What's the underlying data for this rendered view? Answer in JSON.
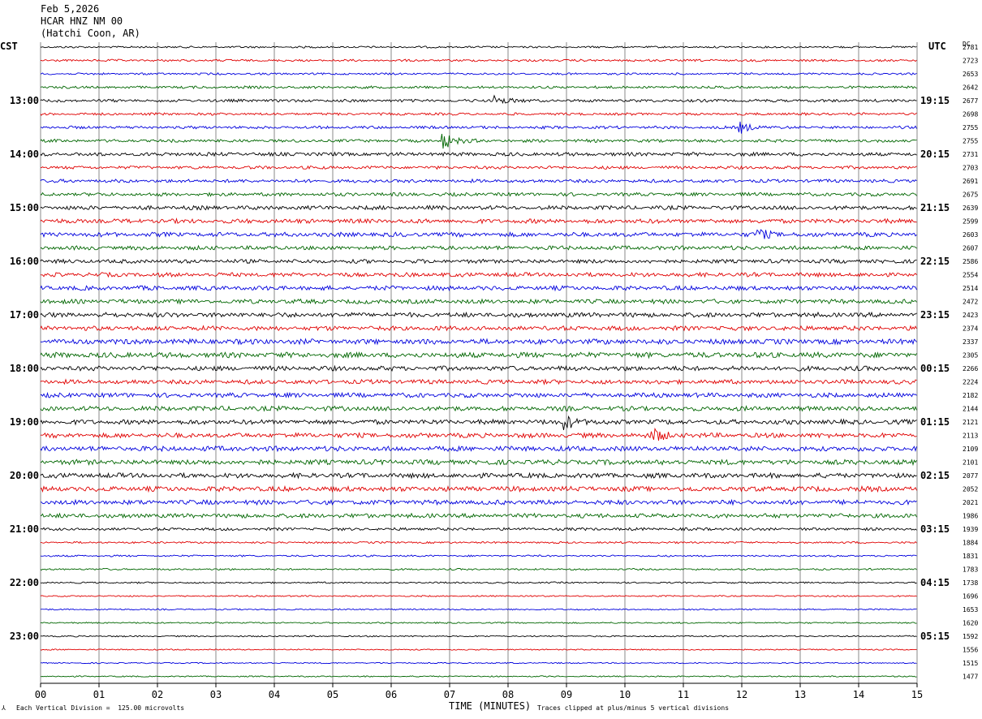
{
  "header": {
    "date": "Feb 5,2026",
    "station": "HCAR HNZ NM 00",
    "location": "(Hatchi Coon, AR)"
  },
  "corner_labels": {
    "left": "CST",
    "right": "UTC",
    "dc": "DC"
  },
  "footer": {
    "scale_note": "Each Vertical Division =  125.00 microvolts",
    "xaxis_title": "TIME (MINUTES)",
    "clip_note": "Traces clipped at plus/minus 5 vertical divisions"
  },
  "colors": {
    "trace_cycle": [
      "#000000",
      "#e00000",
      "#0000dd",
      "#006600"
    ],
    "grid": "#8a8a8a"
  },
  "chart_data": {
    "type": "line",
    "title": "HCAR HNZ NM 00",
    "xlabel": "TIME (MINUTES)",
    "x_ticks": [
      "00",
      "01",
      "02",
      "03",
      "04",
      "05",
      "06",
      "07",
      "08",
      "09",
      "10",
      "11",
      "12",
      "13",
      "14",
      "15"
    ],
    "xlim": [
      0,
      15
    ],
    "left_hour_labels": [
      "13:00",
      "14:00",
      "15:00",
      "16:00",
      "17:00",
      "18:00",
      "19:00",
      "20:00",
      "21:00",
      "22:00",
      "23:00"
    ],
    "right_hour_labels": [
      "19:15",
      "20:15",
      "21:15",
      "22:15",
      "23:15",
      "00:15",
      "01:15",
      "02:15",
      "03:15",
      "04:15",
      "05:15"
    ],
    "dc_offsets": [
      2781,
      2723,
      2653,
      2642,
      2677,
      2698,
      2755,
      2755,
      2731,
      2703,
      2691,
      2675,
      2639,
      2599,
      2603,
      2607,
      2586,
      2554,
      2514,
      2472,
      2423,
      2374,
      2337,
      2305,
      2266,
      2224,
      2182,
      2144,
      2121,
      2113,
      2109,
      2101,
      2077,
      2052,
      2021,
      1986,
      1939,
      1884,
      1831,
      1783,
      1738,
      1696,
      1653,
      1620,
      1592,
      1556,
      1515,
      1477
    ],
    "trace_noise": [
      1.2,
      1.4,
      1.3,
      1.6,
      1.8,
      1.6,
      1.8,
      1.9,
      2.3,
      2.0,
      2.1,
      2.2,
      2.6,
      2.8,
      2.8,
      2.6,
      2.5,
      2.7,
      2.8,
      2.8,
      3.0,
      2.9,
      3.3,
      3.4,
      3.0,
      2.8,
      2.9,
      3.0,
      3.0,
      3.0,
      3.2,
      3.2,
      3.1,
      3.2,
      3.0,
      2.8,
      1.8,
      1.2,
      1.1,
      1.1,
      1.0,
      0.9,
      0.9,
      0.9,
      0.9,
      0.8,
      0.8,
      0.8
    ],
    "events": [
      {
        "trace": 4,
        "minute": 7.8,
        "amplitude": 6
      },
      {
        "trace": 6,
        "minute": 12.0,
        "amplitude": 6
      },
      {
        "trace": 7,
        "minute": 6.9,
        "amplitude": 10
      },
      {
        "trace": 14,
        "minute": 12.3,
        "amplitude": 6
      },
      {
        "trace": 28,
        "minute": 9.0,
        "amplitude": 8
      },
      {
        "trace": 29,
        "minute": 10.5,
        "amplitude": 8
      }
    ]
  }
}
